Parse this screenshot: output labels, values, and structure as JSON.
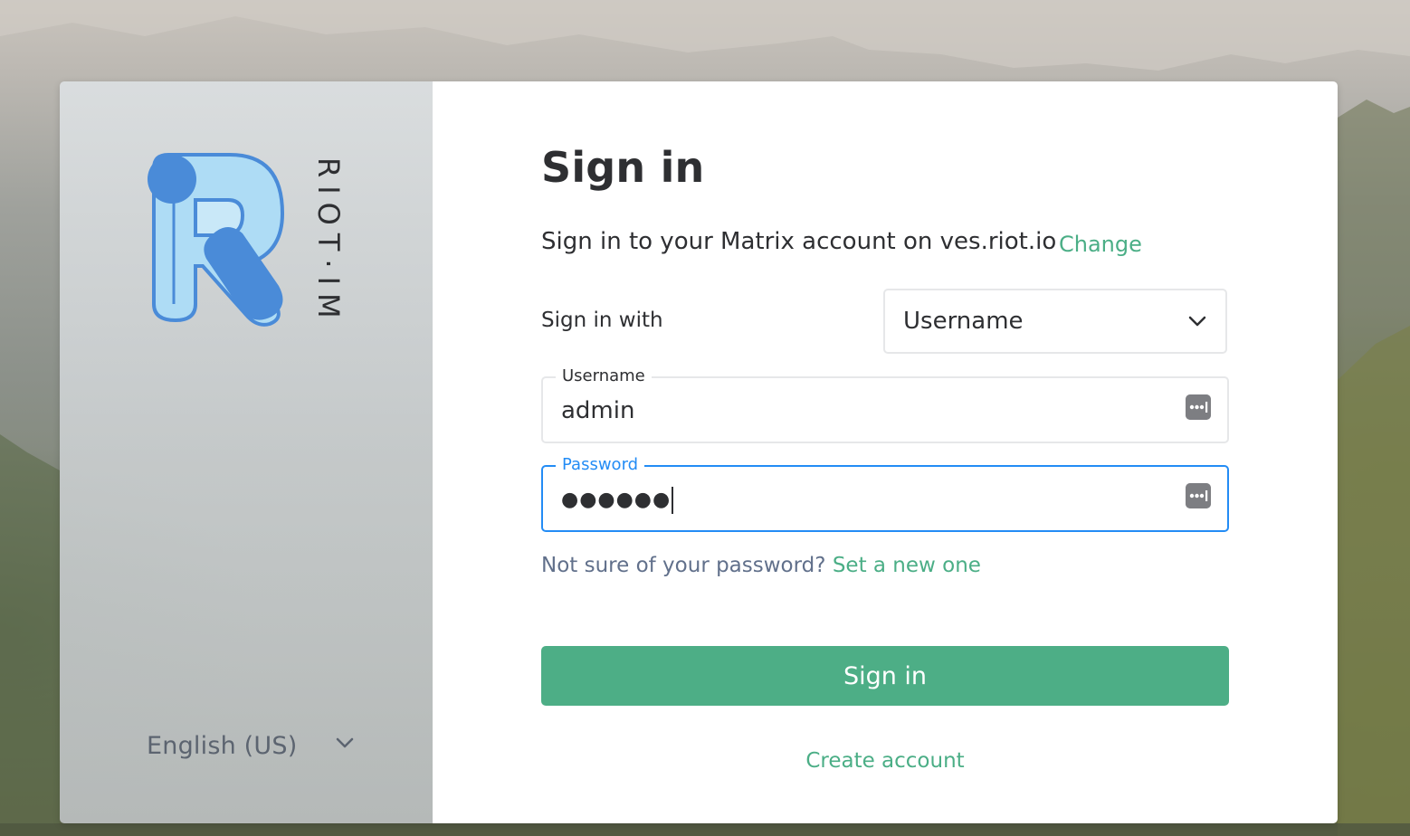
{
  "brand": {
    "wordmark": "RIOT·IM",
    "icon": "riot-logo-icon"
  },
  "language": {
    "selected": "English (US)",
    "icon": "chevron-down-icon"
  },
  "login": {
    "title": "Sign in",
    "server_text": "Sign in to your Matrix account on ves.riot.io",
    "change_label": "Change",
    "sign_in_with_label": "Sign in with",
    "method_selected": "Username",
    "username_label": "Username",
    "username_value": "admin",
    "password_label": "Password",
    "password_value": "●●●●●●",
    "forgot_text": "Not sure of your password?",
    "forgot_link": "Set a new one",
    "submit_label": "Sign in",
    "create_account_label": "Create account"
  },
  "colors": {
    "accent": "#4dae86",
    "focus": "#238cf5",
    "text": "#2e2f32",
    "logo_light": "#aedcf5",
    "logo_dark": "#4a8bd8"
  }
}
